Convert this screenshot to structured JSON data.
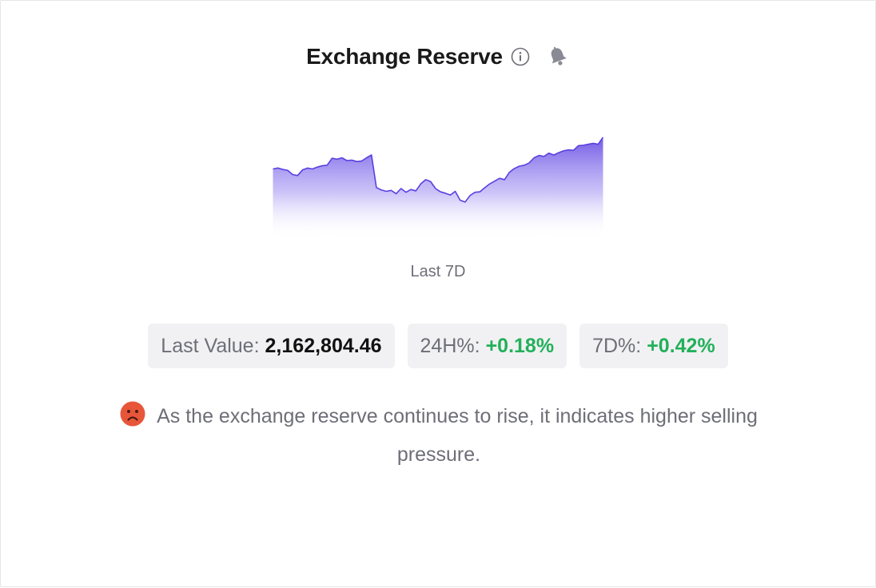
{
  "widget": {
    "title": "Exchange Reserve",
    "info_icon": "info-circle-icon",
    "alert_icon": "bell-icon"
  },
  "chart_data": {
    "type": "area",
    "period_label": "Last 7D",
    "series": [
      {
        "values": [
          2153500,
          2153700,
          2153400,
          2153200,
          2152300,
          2152100,
          2153300,
          2153700,
          2153500,
          2153900,
          2154200,
          2154300,
          2155800,
          2155600,
          2155900,
          2155300,
          2155400,
          2155100,
          2155200,
          2155900,
          2156500,
          2149500,
          2149000,
          2148700,
          2148900,
          2148200,
          2149300,
          2148500,
          2149100,
          2148800,
          2150300,
          2151200,
          2150800,
          2149300,
          2148600,
          2148300,
          2147900,
          2148700,
          2146800,
          2146400,
          2147800,
          2148500,
          2148600,
          2149500,
          2150300,
          2150900,
          2151500,
          2151200,
          2152800,
          2153600,
          2154100,
          2154300,
          2154800,
          2155900,
          2156400,
          2156200,
          2156900,
          2156500,
          2157000,
          2157400,
          2157600,
          2157500,
          2158500,
          2158600,
          2158800,
          2159000,
          2158800,
          2160300
        ]
      }
    ],
    "ylim": [
      2138500,
      2162500
    ],
    "grid": false,
    "color": "#5b3fe0"
  },
  "stats": {
    "last_value_label": "Last Value:",
    "last_value": "2,162,804.46",
    "change_24h_label": "24H%:",
    "change_24h": "+0.18%",
    "change_7d_label": "7D%:",
    "change_7d": "+0.42%"
  },
  "sentiment": {
    "icon": "sad-face-icon",
    "text": "As the exchange reserve continues to rise, it indicates higher selling pressure."
  },
  "colors": {
    "accent": "#5b3fe0",
    "positive": "#22b05a",
    "negative_icon": "#e8563a",
    "muted_text": "#6e6e78"
  }
}
